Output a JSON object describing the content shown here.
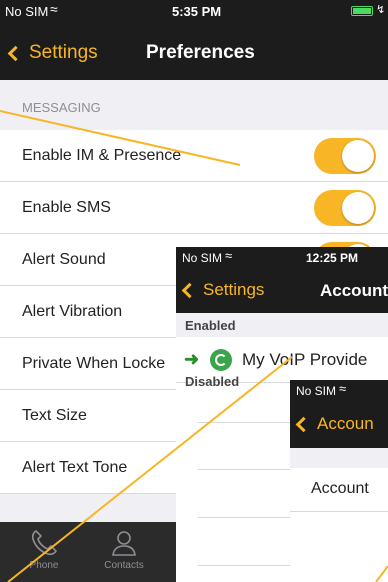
{
  "colors": {
    "accent": "#f8b526",
    "bar": "#1c1c1c",
    "group_bg": "#efeff4",
    "callout": "#f8b526",
    "arrow_green": "#2a8c2a"
  },
  "screen_preferences": {
    "status": {
      "carrier": "No SIM",
      "wifi_icon": "wifi-icon",
      "time": "5:35 PM"
    },
    "nav": {
      "back_label": "Settings",
      "title": "Preferences"
    },
    "section_header": "MESSAGING",
    "rows": [
      {
        "label": "Enable IM & Presence",
        "toggle": true
      },
      {
        "label": "Enable SMS",
        "toggle": true
      },
      {
        "label": "Alert Sound",
        "toggle": true
      },
      {
        "label": "Alert Vibration"
      },
      {
        "label": "Private When Locke"
      },
      {
        "label": "Text Size"
      },
      {
        "label": "Alert Text Tone"
      }
    ],
    "tabbar": [
      {
        "label": "Phone",
        "icon": "phone-icon"
      },
      {
        "label": "Contacts",
        "icon": "contacts-icon"
      }
    ]
  },
  "screen_accounts": {
    "status": {
      "carrier": "No SIM",
      "time": "12:25 PM"
    },
    "nav": {
      "back_label": "Settings",
      "title": "Account"
    },
    "enabled_header": "Enabled",
    "account_name": "My VoIP Provide",
    "disabled_header": "Disabled"
  },
  "screen_account": {
    "status": {
      "carrier": "No SIM"
    },
    "nav": {
      "back_label": "Accoun"
    },
    "row_label": "Account"
  }
}
